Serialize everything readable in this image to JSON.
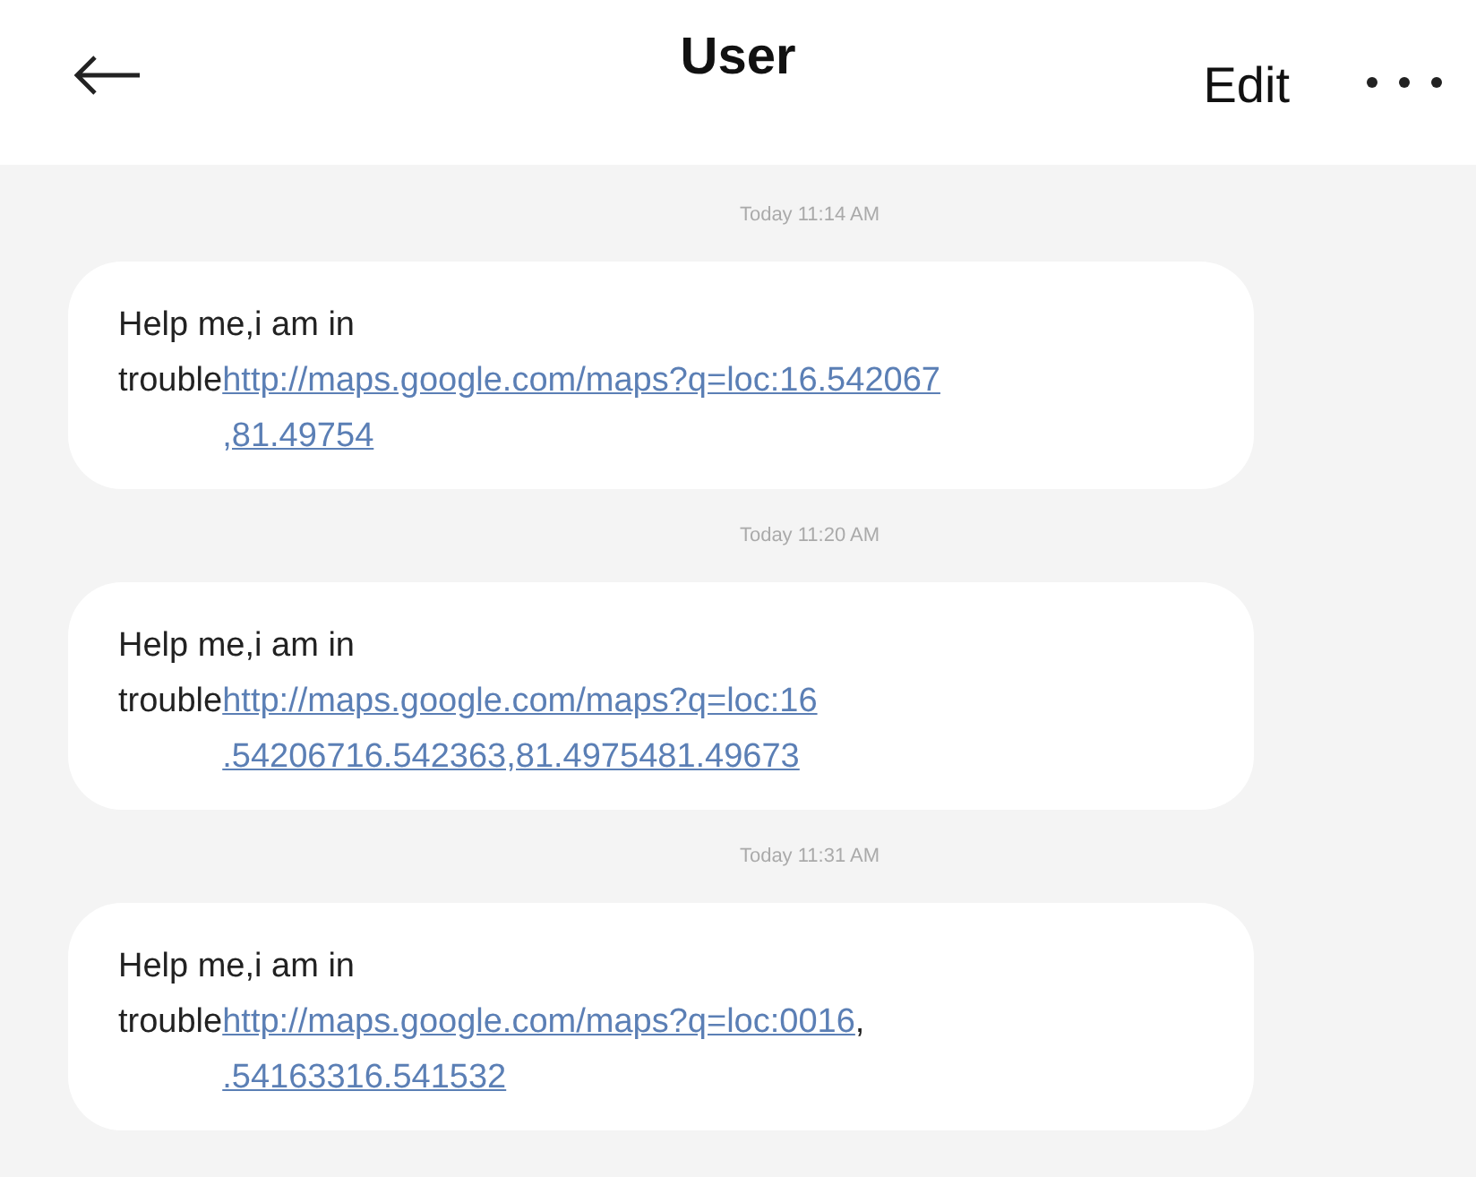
{
  "header": {
    "title": "User",
    "edit_label": "Edit"
  },
  "messages": [
    {
      "time": "Today 11:14 AM",
      "text": "Help me,i am in\ntrouble",
      "link_lines": [
        "http://maps.google.com/maps?q=loc:16.542067",
        ",81.49754"
      ]
    },
    {
      "time": "Today 11:20 AM",
      "text": "Help me,i am in\ntrouble",
      "link_lines": [
        "http://maps.google.com/maps?q=loc:16",
        ".54206716.542363,81.4975481.49673"
      ]
    },
    {
      "time": "Today 11:31 AM",
      "text": "Help me,i am in\ntrouble",
      "link_lines": [
        "http://maps.google.com/maps?q=loc:0016",
        ".54163316.541532"
      ],
      "suffix": ","
    }
  ]
}
